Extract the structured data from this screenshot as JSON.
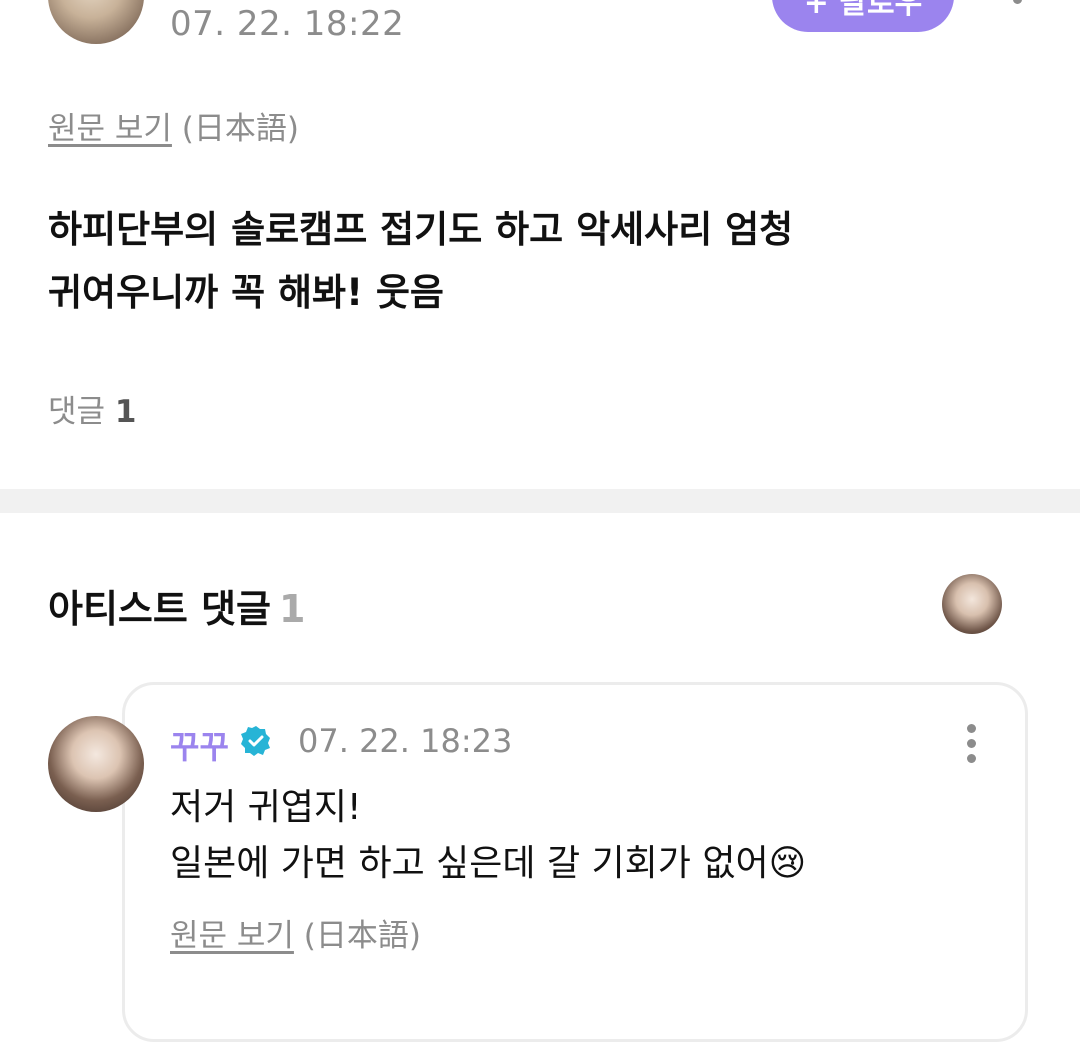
{
  "post": {
    "date": "07. 22. 18:22",
    "follow_label": "+ 팔로우",
    "original_link": "원문 보기",
    "original_lang": "(日本語)",
    "body_line1": "하피단부의 솔로캠프 접기도 하고 악세사리 엄청",
    "body_line2": "귀여우니까 꼭 해봐! 웃음",
    "comment_label": "댓글",
    "comment_count": "1"
  },
  "artist_section": {
    "title": "아티스트 댓글",
    "count": "1"
  },
  "comment": {
    "name": "꾸꾸",
    "date": "07. 22. 18:23",
    "line1": "저거 귀엽지!",
    "line2": "일본에 가면 하고 싶은데 갈 기회가 없어😢",
    "original_link": "원문 보기",
    "original_lang": "(日本語)"
  },
  "colors": {
    "accent": "#9b84ee",
    "muted": "#8c8c8c",
    "verified": "#27b4d6"
  },
  "icons": {
    "verified": "verified-badge-icon",
    "more": "more-vertical-icon"
  }
}
